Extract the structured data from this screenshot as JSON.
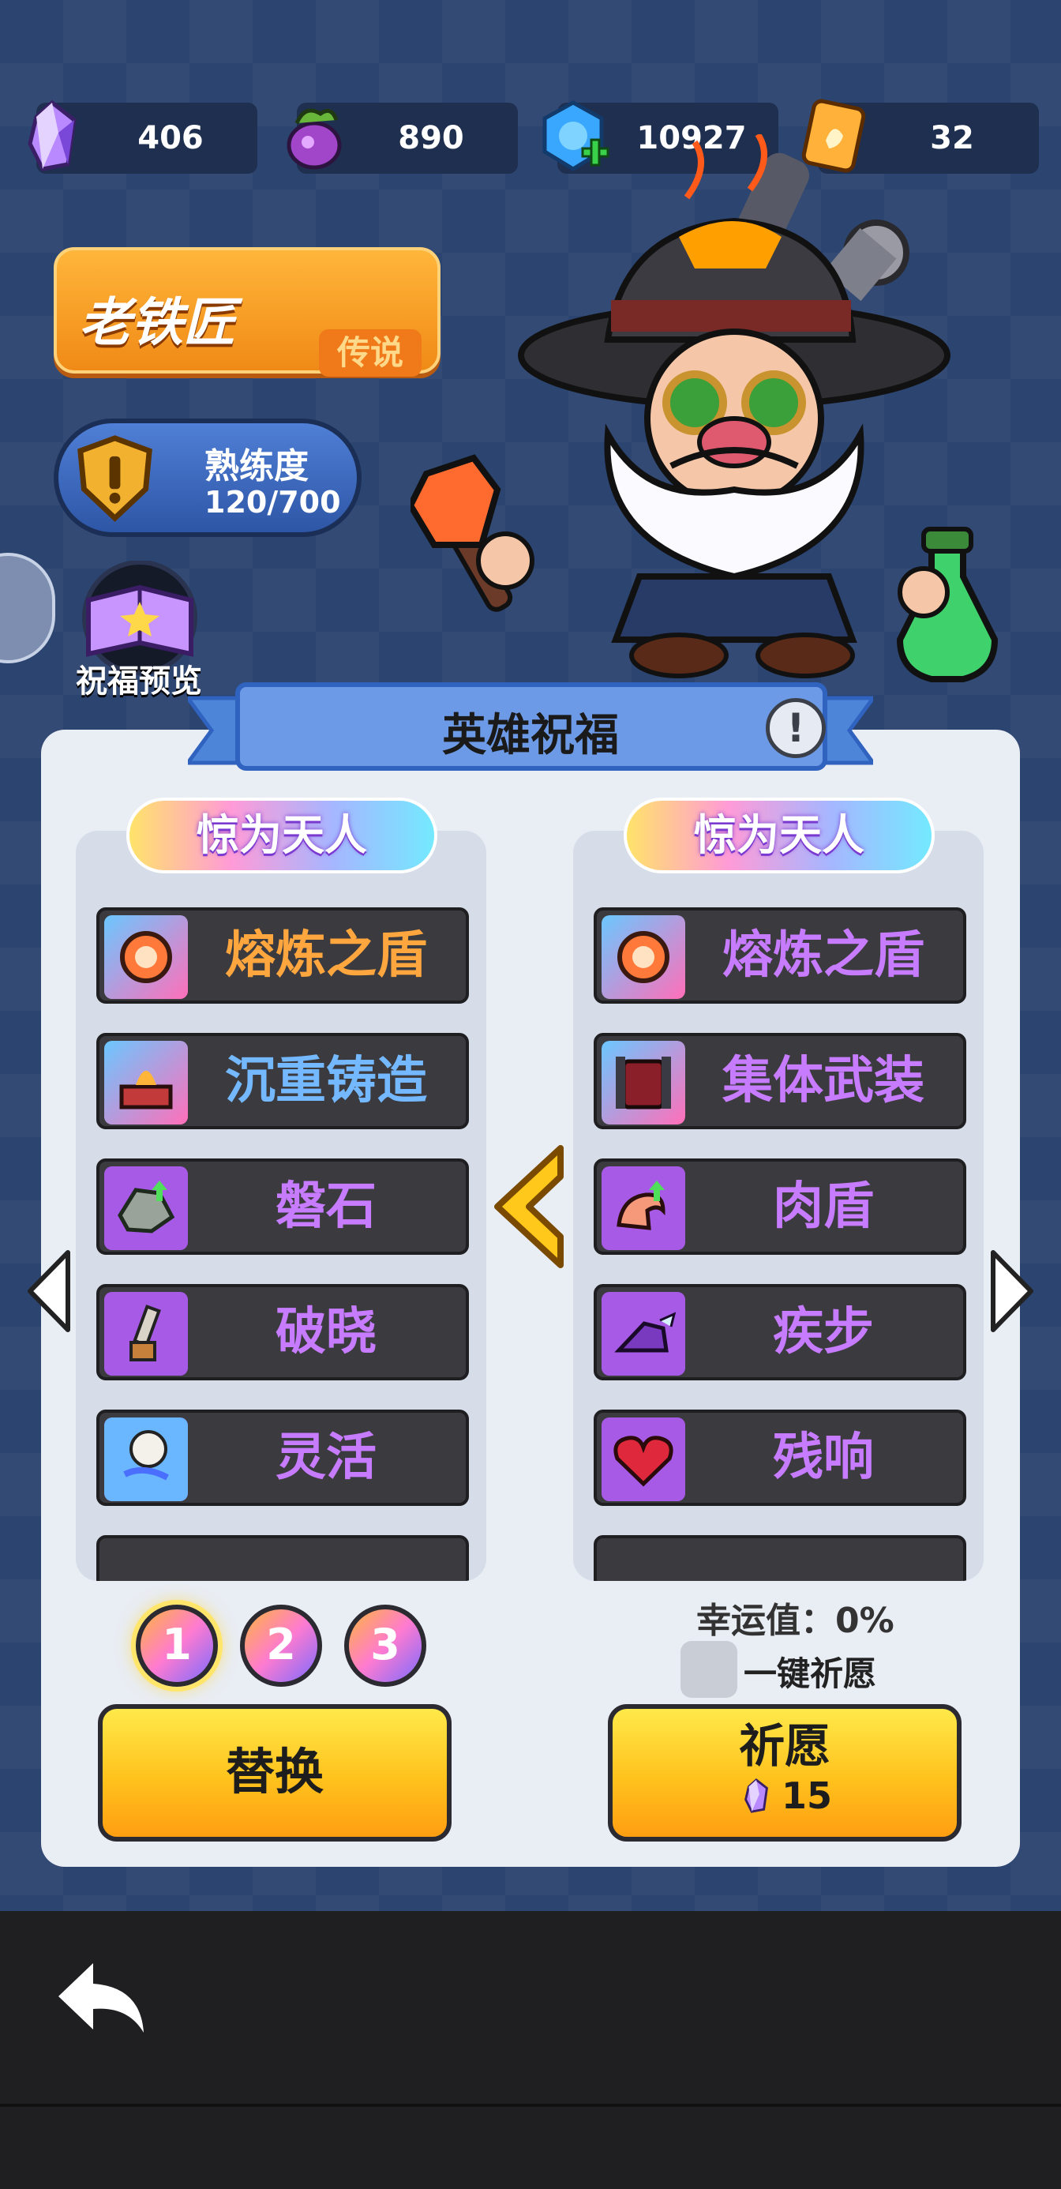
{
  "resources": [
    {
      "name": "gem",
      "value": "406",
      "icon": "crystal-icon"
    },
    {
      "name": "potion",
      "value": "890",
      "icon": "potion-icon"
    },
    {
      "name": "token",
      "value": "10927",
      "icon": "blue-token-plus-icon"
    },
    {
      "name": "scroll",
      "value": "32",
      "icon": "scroll-ticket-icon"
    }
  ],
  "hero": {
    "name": "老铁匠",
    "rarity": "传说"
  },
  "proficiency": {
    "label": "熟练度",
    "value": "120/700"
  },
  "blessing_preview": {
    "label": "祝福预览"
  },
  "panel": {
    "title": "英雄祝福",
    "info_icon": "!",
    "left": {
      "header": "惊为天人",
      "items": [
        {
          "label": "熔炼之盾",
          "color": "#ffa63e",
          "tier": "legend"
        },
        {
          "label": "沉重铸造",
          "color": "#74b8ff",
          "tier": "legend"
        },
        {
          "label": "磐石",
          "color": "#c77bff",
          "tier": "epic"
        },
        {
          "label": "破晓",
          "color": "#c77bff",
          "tier": "epic"
        },
        {
          "label": "灵活",
          "color": "#c77bff",
          "tier": "epic"
        }
      ]
    },
    "right": {
      "header": "惊为天人",
      "items": [
        {
          "label": "熔炼之盾",
          "color": "#c77bff",
          "tier": "legend"
        },
        {
          "label": "集体武装",
          "color": "#c77bff",
          "tier": "legend"
        },
        {
          "label": "肉盾",
          "color": "#c77bff",
          "tier": "epic"
        },
        {
          "label": "疾步",
          "color": "#c77bff",
          "tier": "epic"
        },
        {
          "label": "残响",
          "color": "#c77bff",
          "tier": "epic"
        }
      ]
    },
    "pages": [
      "1",
      "2",
      "3"
    ],
    "active_page": "1",
    "replace_label": "替换",
    "luck_label": "幸运值：0%",
    "auto_wish_label": "一键祈愿",
    "wish_label": "祈愿",
    "wish_cost": "15"
  }
}
